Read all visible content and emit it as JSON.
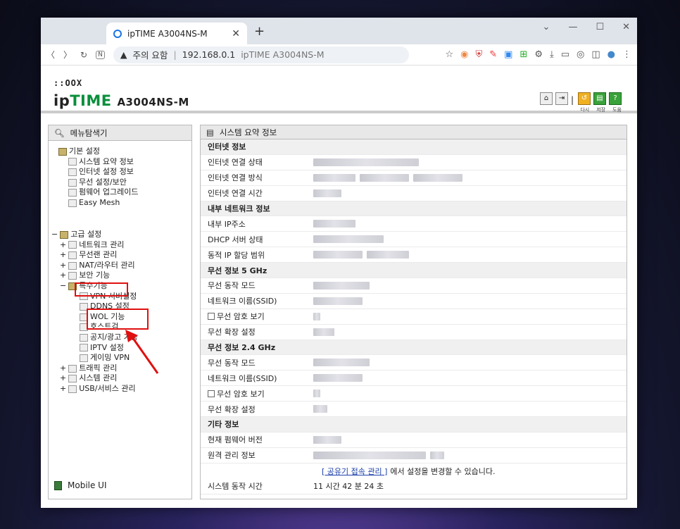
{
  "browser": {
    "tab_title": "ipTIME A3004NS-M",
    "address": {
      "warning": "주의 요함",
      "url": "192.168.0.1",
      "title": "ipTIME A3004NS-M"
    }
  },
  "header": {
    "logo_dots": "::OOX",
    "brand_ip": "ip",
    "brand_time": "TIME",
    "model": "A3004NS-M",
    "icon_labels": [
      "다시",
      "저장",
      "도움"
    ]
  },
  "menu": {
    "title": "메뉴탐색기",
    "basic": {
      "label": "기본 설정",
      "items": [
        "시스템 요약 정보",
        "인터넷 설정 정보",
        "무선 설정/보안",
        "펌웨어 업그레이드",
        "Easy Mesh"
      ]
    },
    "advanced": {
      "label": "고급 설정",
      "items": [
        "네트워크 관리",
        "무선랜 관리",
        "NAT/라우터 관리",
        "보안 기능"
      ],
      "special": "특수기능",
      "special_items": [
        "VPN 서버설정",
        "DDNS 설정",
        "WOL 기능",
        "호스트검",
        "공지/광고 기능",
        "IPTV 설정",
        "게이밍 VPN"
      ],
      "after": [
        "트래픽 관리",
        "시스템 관리",
        "USB/서비스 관리"
      ]
    },
    "mobile": "Mobile UI"
  },
  "summary": {
    "title": "시스템 요약 정보",
    "rows": [
      {
        "sec": "인터넷 정보"
      },
      {
        "k": "인터넷 연결 상태"
      },
      {
        "k": "인터넷 연결 방식"
      },
      {
        "k": "인터넷 연결 시간"
      },
      {
        "sec": "내부 네트워크 정보"
      },
      {
        "k": "내부 IP주소"
      },
      {
        "k": "DHCP 서버 상태"
      },
      {
        "k": "동적 IP 할당 범위"
      },
      {
        "sec": "무선 정보 5 GHz"
      },
      {
        "k": "무선 동작 모드"
      },
      {
        "k": "네트워크 이름(SSID)"
      },
      {
        "k": "무선 암호 보기",
        "cb": true
      },
      {
        "k": "무선 확장 설정"
      },
      {
        "sec": "무선 정보 2.4 GHz"
      },
      {
        "k": "무선 동작 모드"
      },
      {
        "k": "네트워크 이름(SSID)"
      },
      {
        "k": "무선 암호 보기",
        "cb": true
      },
      {
        "k": "무선 확장 설정"
      },
      {
        "sec": "기타 정보"
      },
      {
        "k": "현재 펌웨어 버전"
      },
      {
        "k": "원격 관리 정보"
      }
    ],
    "note_link": "[ 공유기 접속 관리 ]",
    "note_text": "에서 설정을 변경할 수 있습니다.",
    "uptime_label": "시스템 동작 시간",
    "uptime_value": "11 시간 42 분 24 초"
  }
}
